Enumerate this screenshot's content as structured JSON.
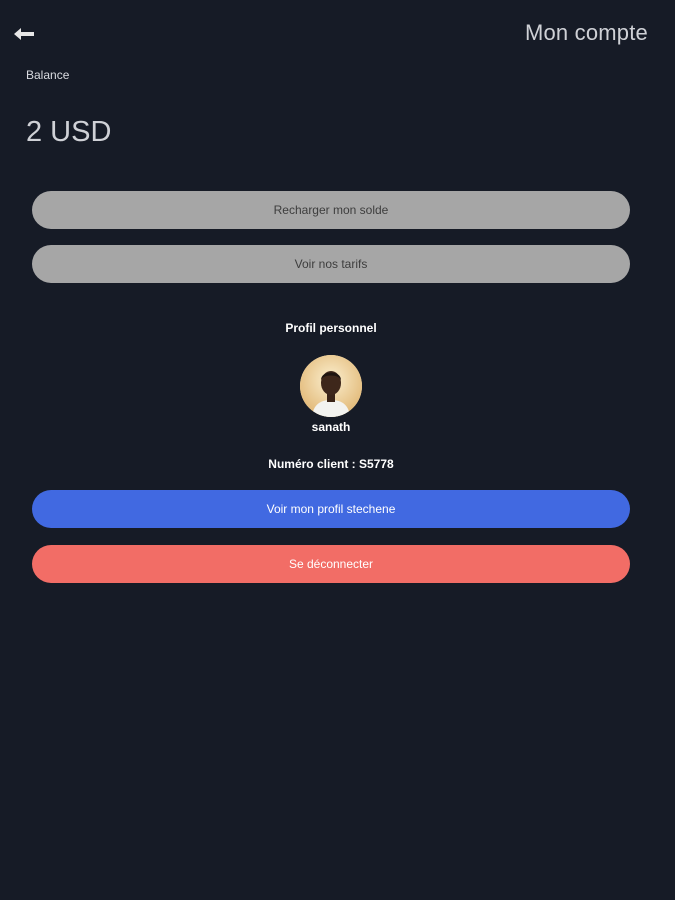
{
  "header": {
    "back_icon": "back-arrow-icon",
    "title": "Mon compte"
  },
  "balance": {
    "label": "Balance",
    "amount": "2 USD"
  },
  "actions": {
    "recharge_label": "Recharger mon solde",
    "tarifs_label": "Voir nos tarifs"
  },
  "profile": {
    "section_title": "Profil personnel",
    "username": "sanath",
    "client_number": "Numéro client : S5778",
    "view_profile_label": "Voir mon profil stechene",
    "logout_label": "Se déconnecter"
  },
  "colors": {
    "background": "#161b26",
    "grey_button": "#a6a6a6",
    "primary_button": "#4169e1",
    "danger_button": "#f26d66"
  }
}
